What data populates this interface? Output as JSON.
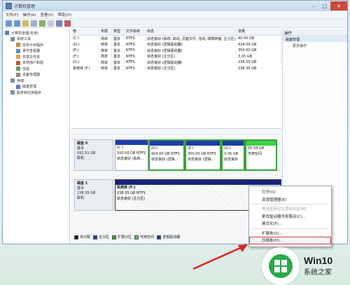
{
  "window": {
    "title": "计算机管理"
  },
  "menubar": [
    "文件(F)",
    "操作(A)",
    "查看(V)",
    "帮助(H)"
  ],
  "tree": [
    {
      "label": "计算机管理(本地)",
      "color": "#5b7fb0",
      "indent": 0
    },
    {
      "label": "系统工具",
      "color": "#7a8fa8",
      "indent": 1
    },
    {
      "label": "任务计划程序",
      "color": "#c88a3a",
      "indent": 2
    },
    {
      "label": "事件查看器",
      "color": "#5a8cc8",
      "indent": 2
    },
    {
      "label": "共享文件夹",
      "color": "#d6a840",
      "indent": 2
    },
    {
      "label": "本地用户和组",
      "color": "#c8504a",
      "indent": 2
    },
    {
      "label": "性能",
      "color": "#6a9c5a",
      "indent": 2
    },
    {
      "label": "设备管理器",
      "color": "#8a8a8a",
      "indent": 2
    },
    {
      "label": "存储",
      "color": "#7a8fa8",
      "indent": 1
    },
    {
      "label": "磁盘管理",
      "color": "#5a7fb5",
      "indent": 2
    },
    {
      "label": "服务和应用程序",
      "color": "#7a8fa8",
      "indent": 1
    }
  ],
  "volume_list": {
    "headers": [
      "卷",
      "布局",
      "类型",
      "文件系统",
      "状态",
      "容量"
    ],
    "rows": [
      [
        "(C:)",
        "简单",
        "基本",
        "NTFS",
        "状态良好 (系统, 启动, 页面文件, 活动, 故障转储, 主分区)",
        "40.00 GB"
      ],
      [
        "(D:)",
        "简单",
        "基本",
        "NTFS",
        "状态良好 (逻辑驱动器)",
        "424.00 GB"
      ],
      [
        "(E:)",
        "简单",
        "基本",
        "NTFS",
        "状态良好 (逻辑驱动器)",
        "350.00 GB"
      ],
      [
        "(F:)",
        "简单",
        "基本",
        "NTFS",
        "状态良好 (主分区)",
        "3.05 GB"
      ],
      [
        "(G:)",
        "简单",
        "基本",
        "NTFS",
        "状态良好 (逻辑驱动器)",
        "238.35 GB"
      ],
      [
        "系统库 (F:)",
        "简单",
        "基本",
        "NTFS",
        "状态良好 (主分区)",
        "238.35 GB"
      ]
    ]
  },
  "actions": {
    "header": "操作",
    "sub": "磁盘管理",
    "more": "更多操作"
  },
  "disk0": {
    "info": [
      "磁盘 0",
      "基本",
      "931.51 GB",
      "联机"
    ],
    "parts": [
      {
        "l1": "(C:)",
        "l2": "100.00 GB NTFS",
        "l3": "状态良好 (系统...",
        "bar": "#1c3ea8",
        "w": 48
      },
      {
        "l1": "(D:)",
        "l2": "424.00 GB NTFS",
        "l3": "状态良好 (逻辑...",
        "bar": "#1c3ea8",
        "w": 52,
        "sel": true
      },
      {
        "l1": "(E:)",
        "l2": "350.00 GB NTFS",
        "l3": "状态良好 (逻辑...",
        "bar": "#1c3ea8",
        "w": 52,
        "sel": true
      },
      {
        "l1": "(G:)",
        "l2": "3.05 GB",
        "l3": "状态良好",
        "bar": "#1c3ea8",
        "w": 34,
        "sel": true
      },
      {
        "l1": "",
        "l2": "55.54 GB",
        "l3": "可用空间",
        "bar": "#3fd04a",
        "w": 46,
        "sel": true
      }
    ]
  },
  "disk1": {
    "info": [
      "磁盘 1",
      "基本",
      "238.35 GB",
      "联机"
    ],
    "part": {
      "l1": "系统库 (F:)",
      "l2": "238.35 GB NTFS",
      "l3": "状态良好 (主分区)"
    }
  },
  "legend": [
    {
      "label": "未分配",
      "color": "#111111"
    },
    {
      "label": "主分区",
      "color": "#1c3ea8"
    },
    {
      "label": "扩展分区",
      "color": "#2fa82f"
    },
    {
      "label": "可用空间",
      "color": "#3fd04a"
    },
    {
      "label": "逻辑驱动器",
      "color": "#1c3ea8"
    }
  ],
  "context_menu": [
    {
      "label": "打开(O)",
      "enabled": true
    },
    {
      "label": "资源管理器(E)",
      "enabled": true
    },
    {
      "sep": true
    },
    {
      "label": "将分区标记为活动分区(M)",
      "enabled": false
    },
    {
      "label": "更改驱动器号和路径(C)...",
      "enabled": true
    },
    {
      "label": "格式化(F)...",
      "enabled": true
    },
    {
      "sep": true
    },
    {
      "label": "扩展卷(X)...",
      "enabled": true
    },
    {
      "label": "压缩卷(H)...",
      "enabled": true,
      "highlight": true
    }
  ],
  "watermark": {
    "brand": "Win10",
    "sub": "系统之家"
  }
}
